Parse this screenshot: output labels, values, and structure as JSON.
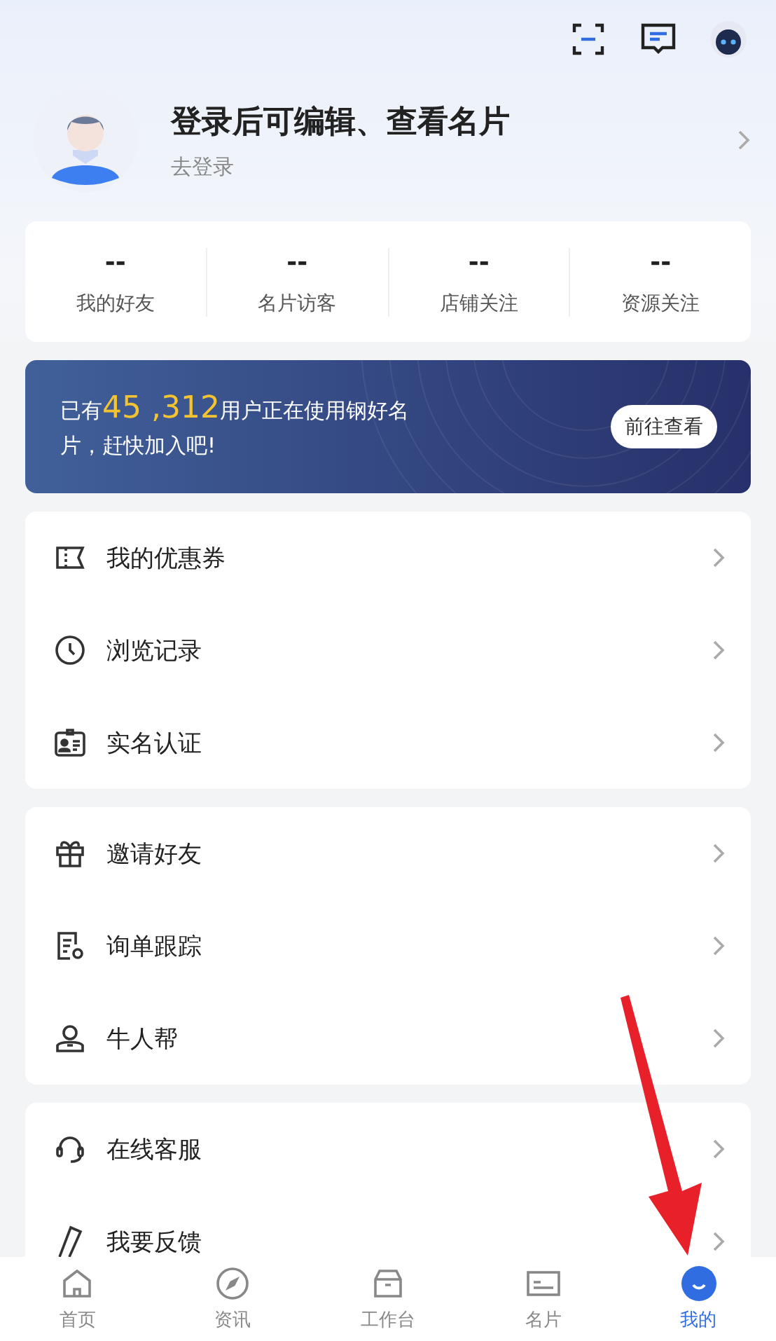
{
  "profile": {
    "title": "登录后可编辑、查看名片",
    "subtitle": "去登录"
  },
  "stats": [
    {
      "value": "--",
      "label": "我的好友"
    },
    {
      "value": "--",
      "label": "名片访客"
    },
    {
      "value": "--",
      "label": "店铺关注"
    },
    {
      "value": "--",
      "label": "资源关注"
    }
  ],
  "banner": {
    "prefix": "已有",
    "count": "45 ,312",
    "suffix": "用户正在使用钢好名片，赶快加入吧!",
    "button": "前往查看"
  },
  "menu_groups": [
    [
      {
        "kind": "coupon",
        "label": "我的优惠券"
      },
      {
        "kind": "clock",
        "label": "浏览记录"
      },
      {
        "kind": "idcard",
        "label": "实名认证"
      }
    ],
    [
      {
        "kind": "gift",
        "label": "邀请好友"
      },
      {
        "kind": "order",
        "label": "询单跟踪"
      },
      {
        "kind": "person",
        "label": "牛人帮"
      }
    ],
    [
      {
        "kind": "headset",
        "label": "在线客服"
      },
      {
        "kind": "pen",
        "label": "我要反馈"
      }
    ]
  ],
  "tabs": [
    {
      "kind": "home",
      "label": "首页",
      "selected": false
    },
    {
      "kind": "compass",
      "label": "资讯",
      "selected": false
    },
    {
      "kind": "box",
      "label": "工作台",
      "selected": false
    },
    {
      "kind": "card",
      "label": "名片",
      "selected": false
    },
    {
      "kind": "face",
      "label": "我的",
      "selected": true
    }
  ]
}
